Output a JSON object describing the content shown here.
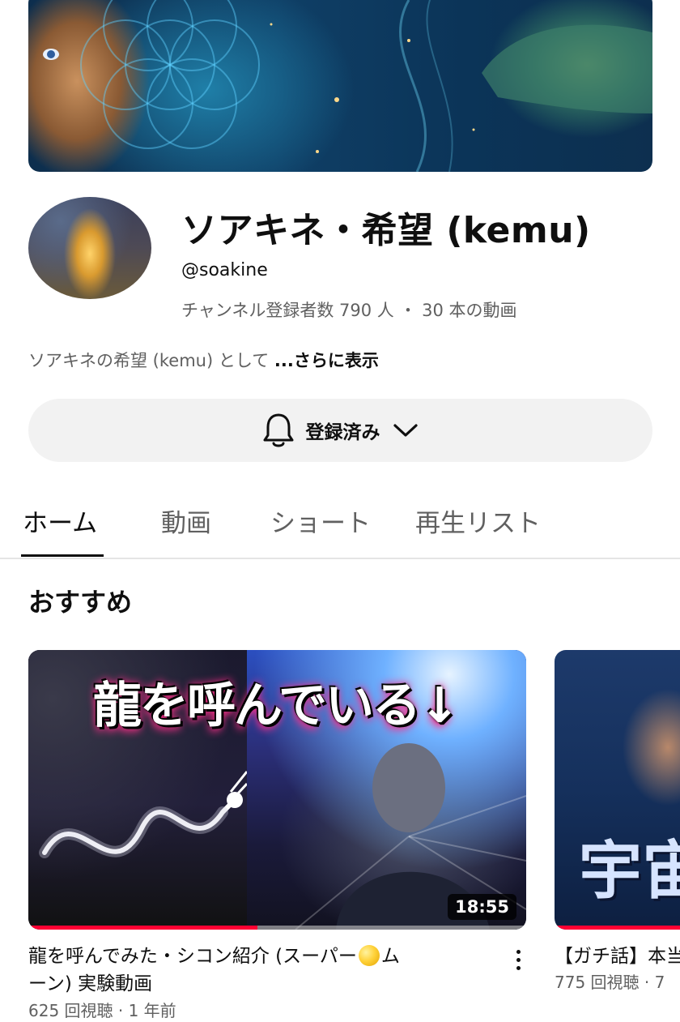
{
  "channel": {
    "name": "ソアキネ・希望 (kemu)",
    "handle": "@soakine",
    "stats": "チャンネル登録者数 790 人 ・ 30 本の動画",
    "description": "ソアキネの希望 (kemu) として ",
    "description_more": "...さらに表示"
  },
  "subscribe": {
    "label": "登録済み",
    "bell_icon": "bell-icon",
    "chevron_icon": "chevron-down-icon"
  },
  "tabs": [
    {
      "label": "ホーム",
      "active": true
    },
    {
      "label": "動画",
      "active": false
    },
    {
      "label": "ショート",
      "active": false
    },
    {
      "label": "再生リスト",
      "active": false
    }
  ],
  "section": {
    "title": "おすすめ"
  },
  "videos": [
    {
      "thumbnail_text": "龍を呼んでいる↓",
      "duration": "18:55",
      "watched_fraction": 0.46,
      "title_part1": "龍を呼んでみた・シコン紹介 (スーパー",
      "title_part2": "ム",
      "title_part3": "ーン) 実験動画",
      "meta": "625 回視聴 · 1 年前"
    },
    {
      "thumbnail_text": "宇宙",
      "title": "【ガチ話】本当",
      "meta": "775 回視聴 · 7"
    }
  ],
  "colors": {
    "accent_red": "#ff0033",
    "secondary_text": "#606060"
  }
}
